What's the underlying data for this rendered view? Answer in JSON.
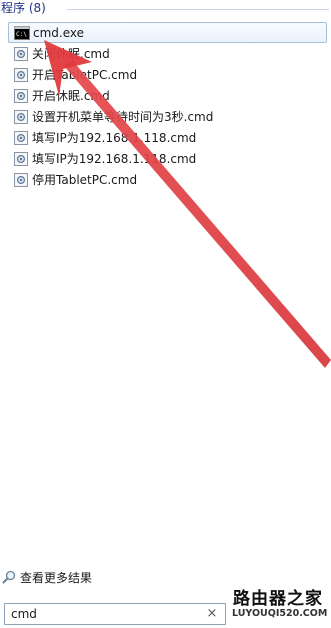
{
  "section": {
    "title": "程序 (8)"
  },
  "results": [
    {
      "label": "cmd.exe",
      "icon": "cmd-console-icon",
      "selected": true
    },
    {
      "label": "关闭休眠.cmd",
      "icon": "cmd-script-icon"
    },
    {
      "label": "开启TabletPC.cmd",
      "icon": "cmd-script-icon"
    },
    {
      "label": "开启休眠.cmd",
      "icon": "cmd-script-icon"
    },
    {
      "label": "设置开机菜单等待时间为3秒.cmd",
      "icon": "cmd-script-icon"
    },
    {
      "label": "填写IP为192.168.1.118.cmd",
      "icon": "cmd-script-icon"
    },
    {
      "label": "填写IP为192.168.1.118.cmd",
      "icon": "cmd-script-icon"
    },
    {
      "label": "停用TabletPC.cmd",
      "icon": "cmd-script-icon"
    }
  ],
  "see_more": {
    "label": "查看更多结果",
    "icon": "magnifier-icon"
  },
  "search": {
    "value": "cmd",
    "clear_label": "×"
  },
  "annotation": {
    "arrow_color": "#e03a3e"
  },
  "watermark": {
    "title": "路由器之家",
    "url": "LUYOUQI520.COM"
  }
}
